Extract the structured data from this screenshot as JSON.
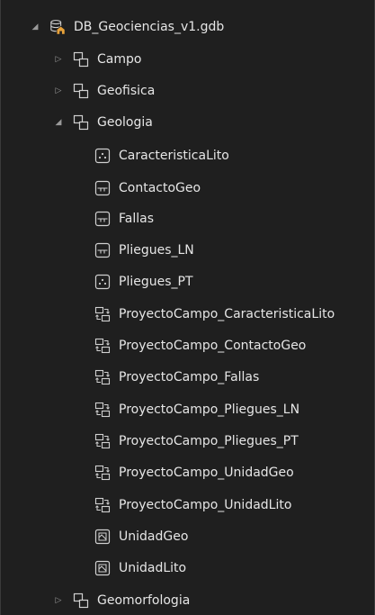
{
  "tree": {
    "root": {
      "label": "DB_Geociencias_v1.gdb",
      "expanded": true,
      "icon": "geodatabase-icon"
    },
    "datasets": [
      {
        "label": "Campo",
        "expanded": false,
        "icon": "feature-dataset-icon"
      },
      {
        "label": "Geofisica",
        "expanded": false,
        "icon": "feature-dataset-icon"
      },
      {
        "label": "Geologia",
        "expanded": true,
        "icon": "feature-dataset-icon"
      },
      {
        "label": "Geomorfologia",
        "expanded": false,
        "icon": "feature-dataset-icon"
      }
    ],
    "geologia_items": [
      {
        "label": "CaracteristicaLito",
        "icon": "point-feature-class-icon"
      },
      {
        "label": "ContactoGeo",
        "icon": "line-feature-class-icon"
      },
      {
        "label": "Fallas",
        "icon": "line-feature-class-icon"
      },
      {
        "label": "Pliegues_LN",
        "icon": "line-feature-class-icon"
      },
      {
        "label": "Pliegues_PT",
        "icon": "point-feature-class-icon"
      },
      {
        "label": "ProyectoCampo_CaracteristicaLito",
        "icon": "relationship-class-icon"
      },
      {
        "label": "ProyectoCampo_ContactoGeo",
        "icon": "relationship-class-icon"
      },
      {
        "label": "ProyectoCampo_Fallas",
        "icon": "relationship-class-icon"
      },
      {
        "label": "ProyectoCampo_Pliegues_LN",
        "icon": "relationship-class-icon"
      },
      {
        "label": "ProyectoCampo_Pliegues_PT",
        "icon": "relationship-class-icon"
      },
      {
        "label": "ProyectoCampo_UnidadGeo",
        "icon": "relationship-class-icon"
      },
      {
        "label": "ProyectoCampo_UnidadLito",
        "icon": "relationship-class-icon"
      },
      {
        "label": "UnidadGeo",
        "icon": "raster-icon"
      },
      {
        "label": "UnidadLito",
        "icon": "raster-icon"
      }
    ]
  },
  "colors": {
    "background": "#1f1f1f",
    "text": "#e6e6e6",
    "chevron": "#9a9a9a",
    "icon": "#d0d0d0"
  }
}
